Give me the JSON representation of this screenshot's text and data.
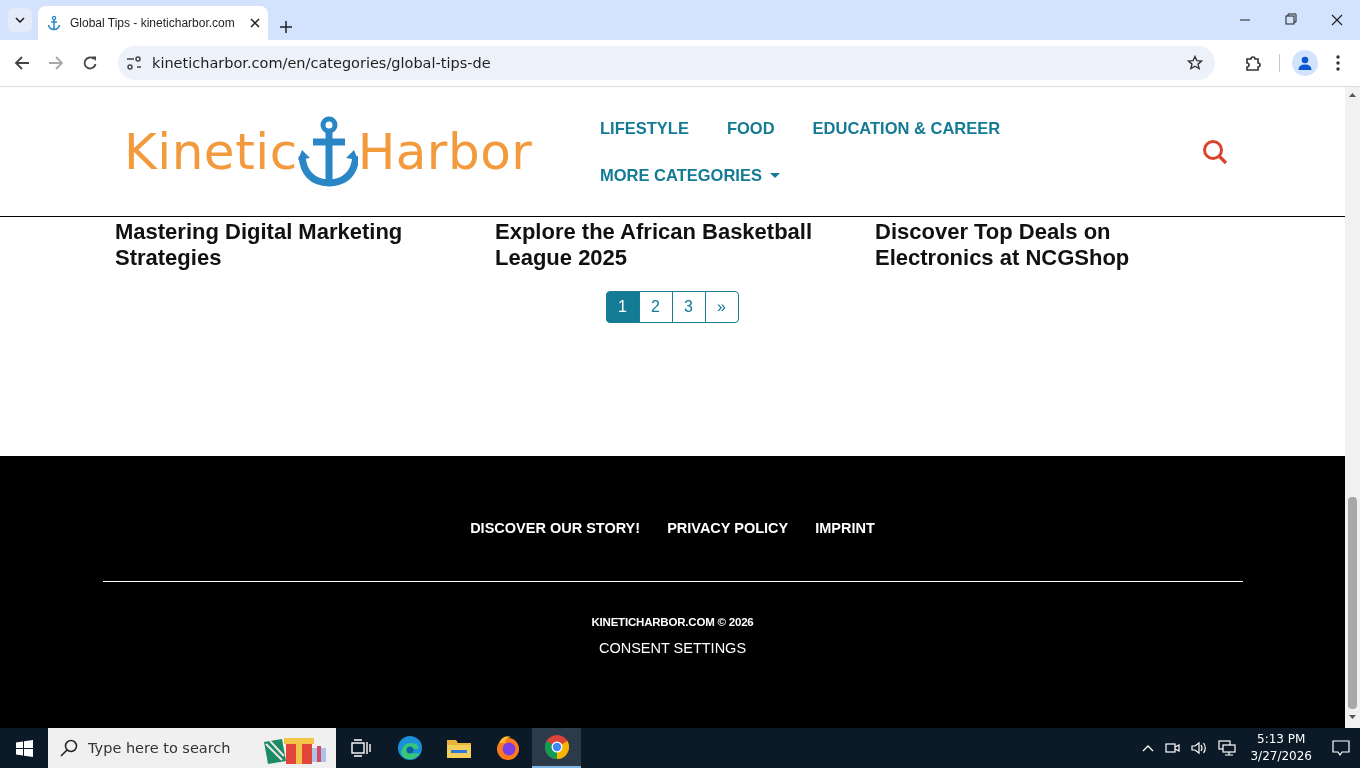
{
  "browser": {
    "tabs": [
      {
        "title": "Global Tips - kineticharbor.com",
        "selected": true
      }
    ],
    "address_bar": {
      "url": "kineticharbor.com/en/categories/global-tips-de"
    }
  },
  "header": {
    "logo": {
      "word_1": "Kinetic",
      "word_2": "Harbor"
    },
    "nav": [
      {
        "label": "LIFESTYLE",
        "kind": "link"
      },
      {
        "label": "FOOD",
        "kind": "link"
      },
      {
        "label": "EDUCATION & CAREER",
        "kind": "link"
      },
      {
        "label": "MORE CATEGORIES",
        "kind": "dropdown"
      }
    ]
  },
  "articles": [
    {
      "title": "Mastering Digital Marketing Strategies"
    },
    {
      "title": "Explore the African Basketball League 2025"
    },
    {
      "title": "Discover Top Deals on Electronics at NCGShop"
    }
  ],
  "pagination": [
    {
      "label": "1",
      "selected": true
    },
    {
      "label": "2",
      "selected": false
    },
    {
      "label": "3",
      "selected": false
    },
    {
      "label": "»",
      "selected": false
    }
  ],
  "footer": {
    "links": [
      "DISCOVER OUR STORY!",
      "PRIVACY POLICY",
      "IMPRINT"
    ],
    "copyright": "KINETICHARBOR.COM © 2026",
    "consent": "CONSENT SETTINGS"
  },
  "taskbar": {
    "search": {
      "placeholder": "Type here to search"
    },
    "apps": [
      {
        "kind": "taskview",
        "selected": false
      },
      {
        "kind": "edge",
        "selected": false
      },
      {
        "kind": "folder",
        "selected": false
      },
      {
        "kind": "firefox",
        "selected": false
      },
      {
        "kind": "chrome",
        "selected": true
      }
    ],
    "clock": {
      "time": "5:13 PM",
      "date": "3/27/2026"
    }
  }
}
